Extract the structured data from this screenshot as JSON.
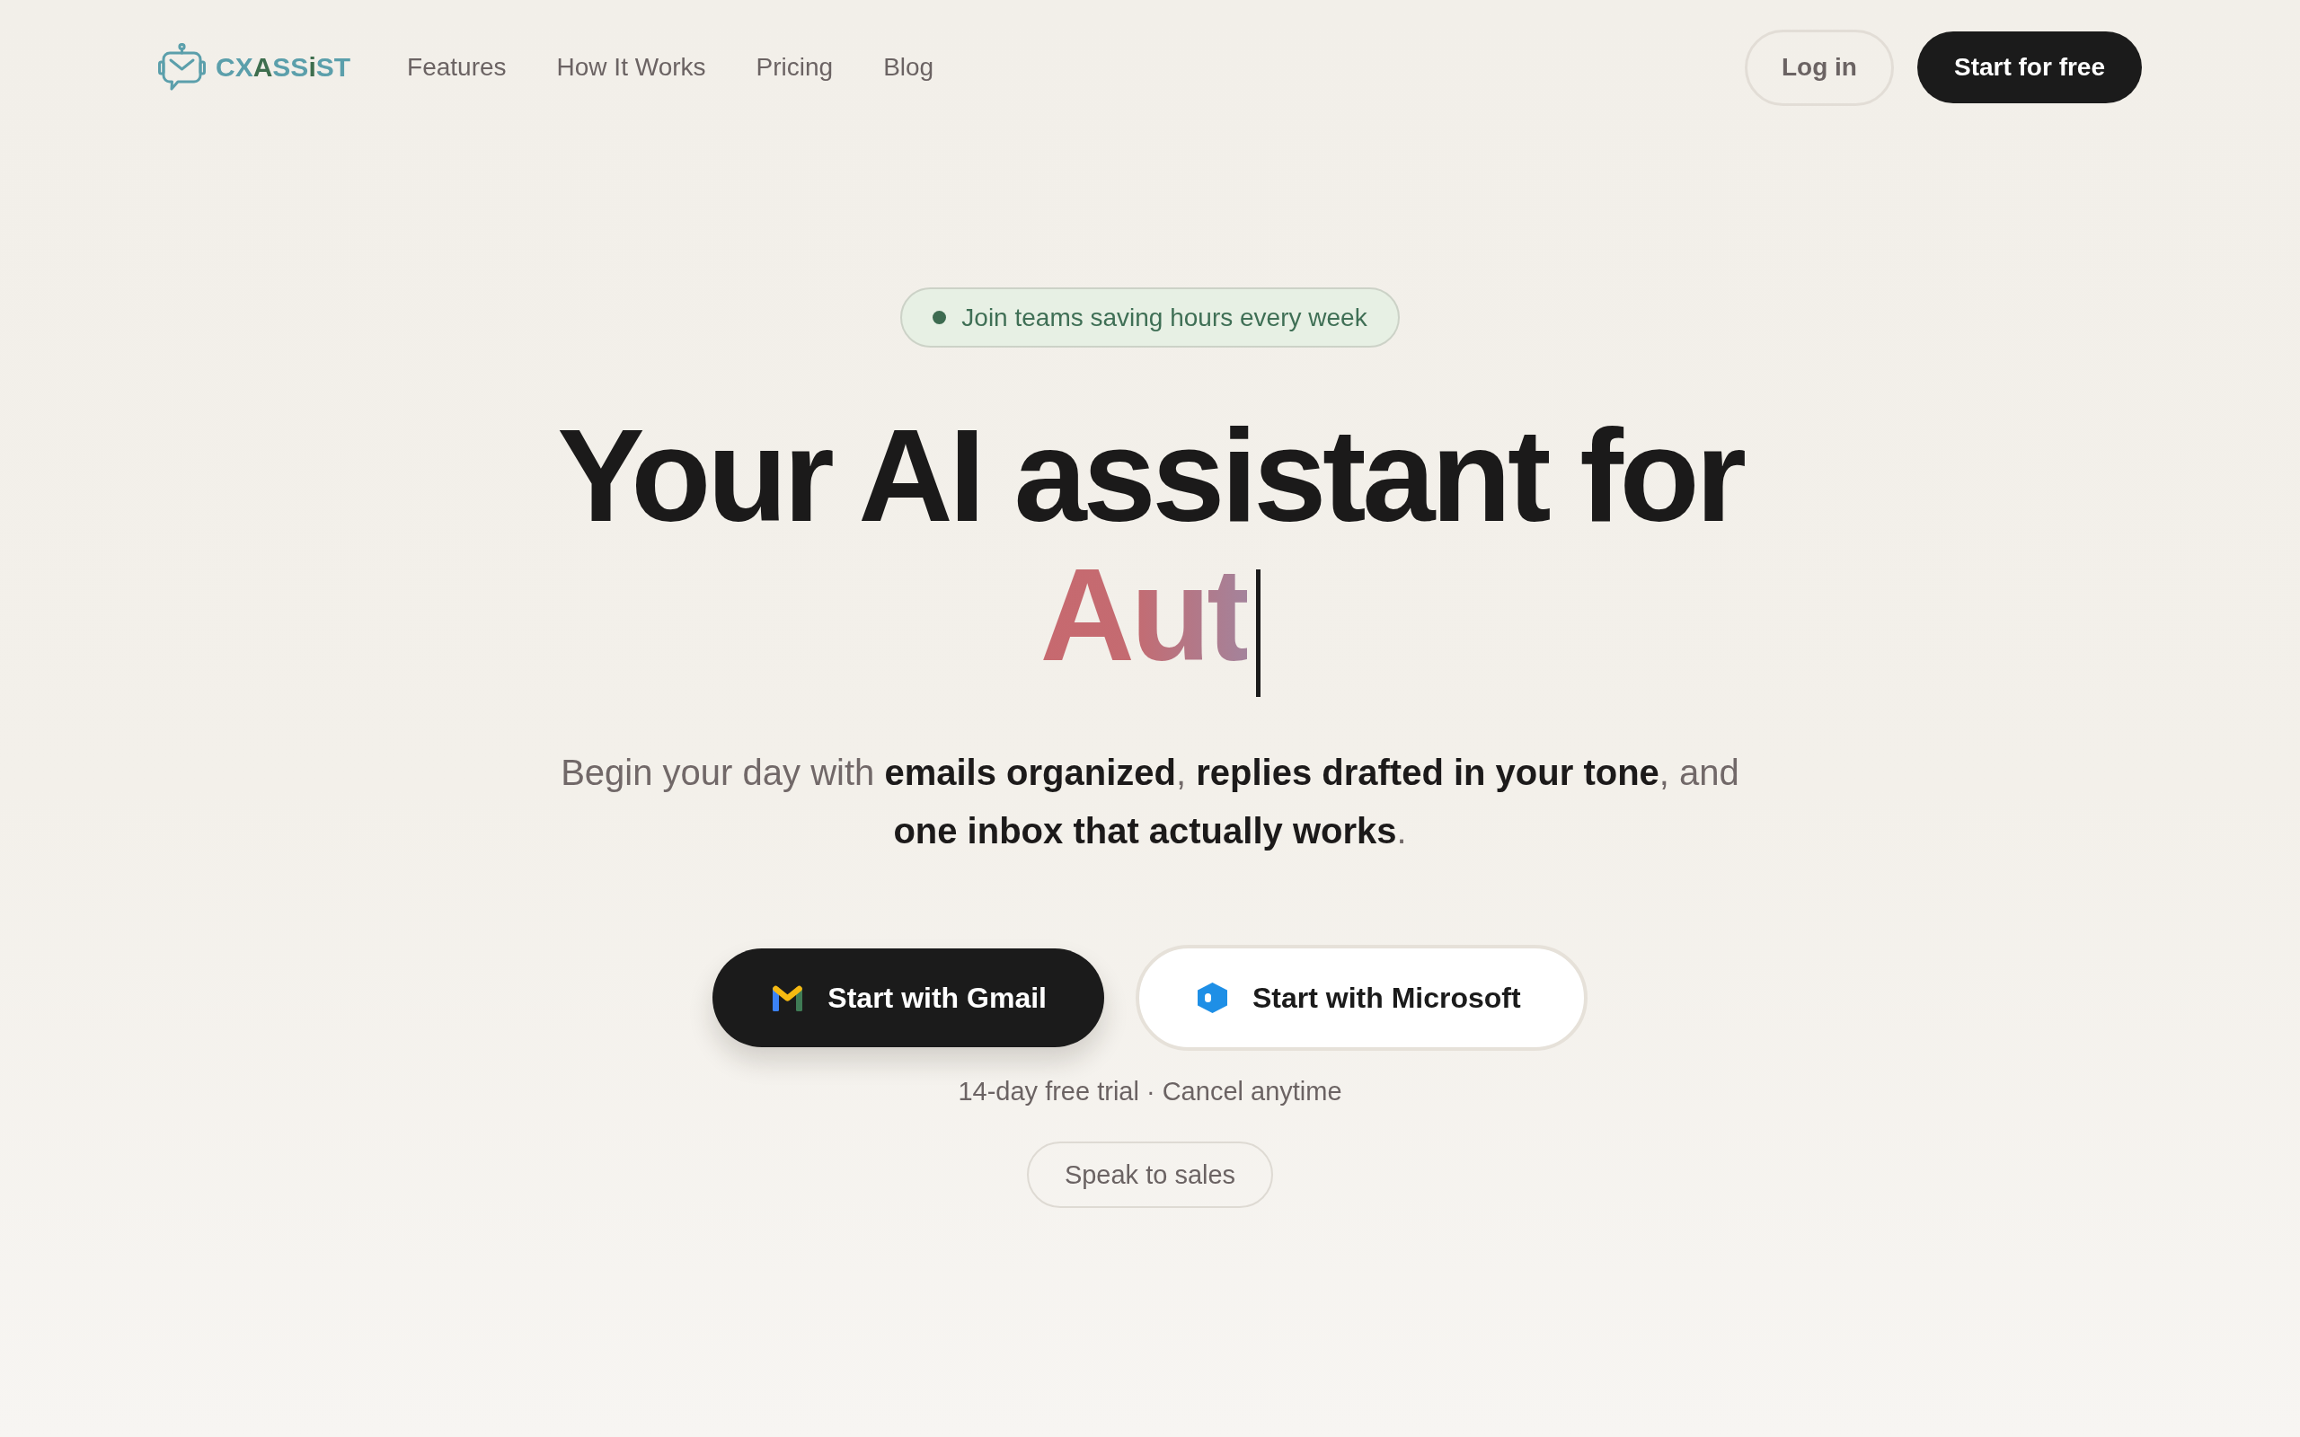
{
  "nav": {
    "logo": {
      "parts": [
        {
          "text": "CX",
          "color": "#5b9fab"
        },
        {
          "text": "A",
          "color": "#3e6e4e"
        },
        {
          "text": "SS",
          "color": "#5b9fab"
        },
        {
          "text": "i",
          "color": "#3e6e4e"
        },
        {
          "text": "ST",
          "color": "#5b9fab"
        }
      ]
    },
    "links": [
      "Features",
      "How It Works",
      "Pricing",
      "Blog"
    ],
    "login_button": "Log in",
    "cta_button": "Start for free"
  },
  "hero": {
    "badge": "Join teams saving hours every week",
    "headline": "Your AI assistant for",
    "typed_text": "Aut",
    "subtitle": "Begin your day with **emails organized**, **replies drafted in your tone**, and **one inbox that actually works**.",
    "buttons": [
      {
        "label": "Start with Gmail",
        "kind": "gmail"
      },
      {
        "label": "Start with Microsoft",
        "kind": "microsoft"
      }
    ],
    "note": "14-day free trial · Cancel anytime",
    "sales_button": "Speak to sales"
  }
}
